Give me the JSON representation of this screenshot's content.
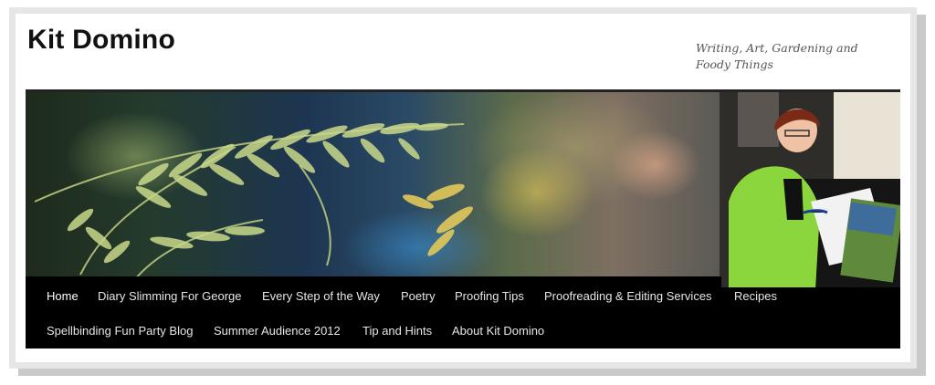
{
  "site": {
    "title": "Kit Domino",
    "description": "Writing, Art, Gardening and Foody Things"
  },
  "banner": {
    "image_left": "fern-photo",
    "image_right": "author-portrait"
  },
  "nav": {
    "items": [
      {
        "label": "Home",
        "active": true
      },
      {
        "label": "Diary Slimming For George"
      },
      {
        "label": "Every Step of the Way"
      },
      {
        "label": "Poetry"
      },
      {
        "label": "Proofing Tips"
      },
      {
        "label": "Proofreading & Editing Services"
      },
      {
        "label": "Recipes"
      },
      {
        "label": "Spellbinding Fun Party Blog"
      },
      {
        "label": "Summer Audience 2012"
      },
      {
        "label": "Tip and Hints"
      },
      {
        "label": "About Kit Domino"
      }
    ]
  },
  "colors": {
    "nav_background": "#000000",
    "nav_text": "#e6e6e6",
    "frame_border": "#e6e6e6",
    "shadow": "#c9c9c9"
  }
}
